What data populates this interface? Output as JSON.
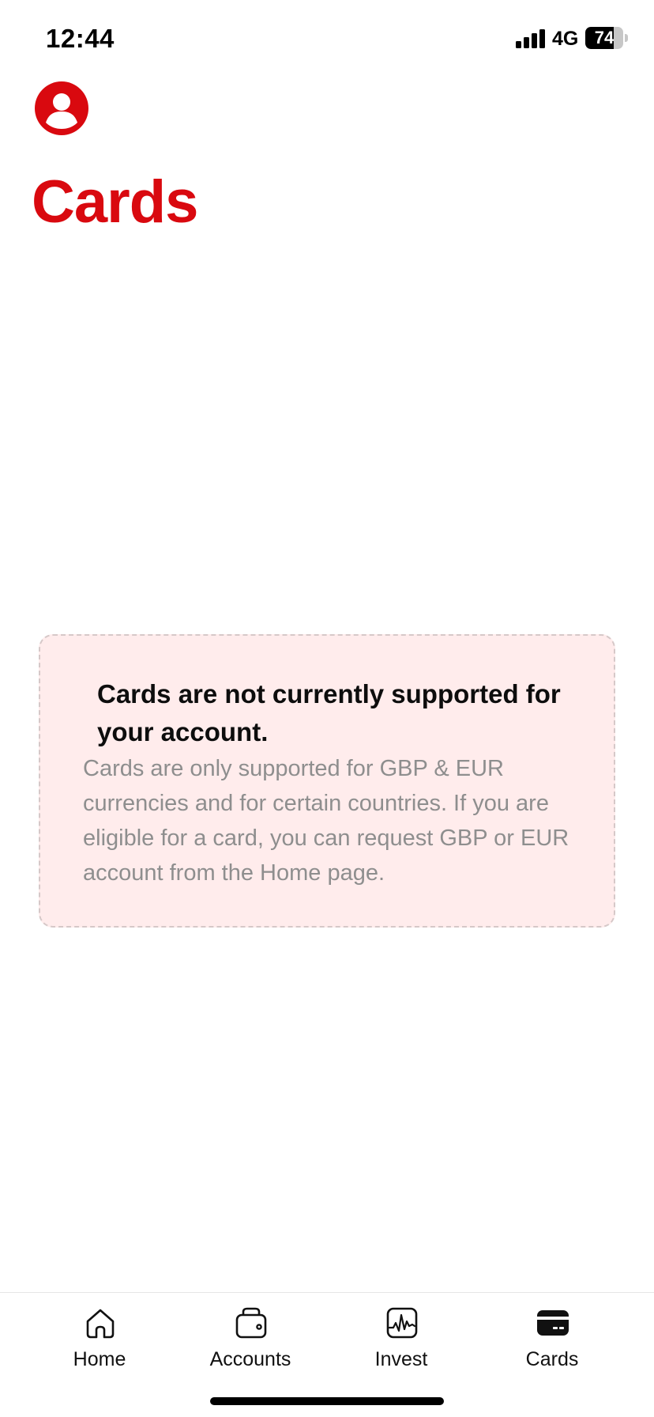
{
  "status_bar": {
    "time": "12:44",
    "network": "4G",
    "battery_percent": 74,
    "battery_label": "74"
  },
  "header": {
    "title": "Cards"
  },
  "notice": {
    "title": "Cards are not currently supported for your account.",
    "body": "Cards are only supported for GBP & EUR currencies and for certain countries. If you are eligible for a card, you can request GBP or EUR account from the Home page."
  },
  "tabs": [
    {
      "label": "Home",
      "icon": "home-icon",
      "active": false
    },
    {
      "label": "Accounts",
      "icon": "wallet-icon",
      "active": false
    },
    {
      "label": "Invest",
      "icon": "chart-icon",
      "active": false
    },
    {
      "label": "Cards",
      "icon": "card-icon",
      "active": true
    }
  ],
  "colors": {
    "brand": "#d9090f",
    "notice_background": "#ffecec",
    "notice_body_text": "#8e8e8e"
  }
}
